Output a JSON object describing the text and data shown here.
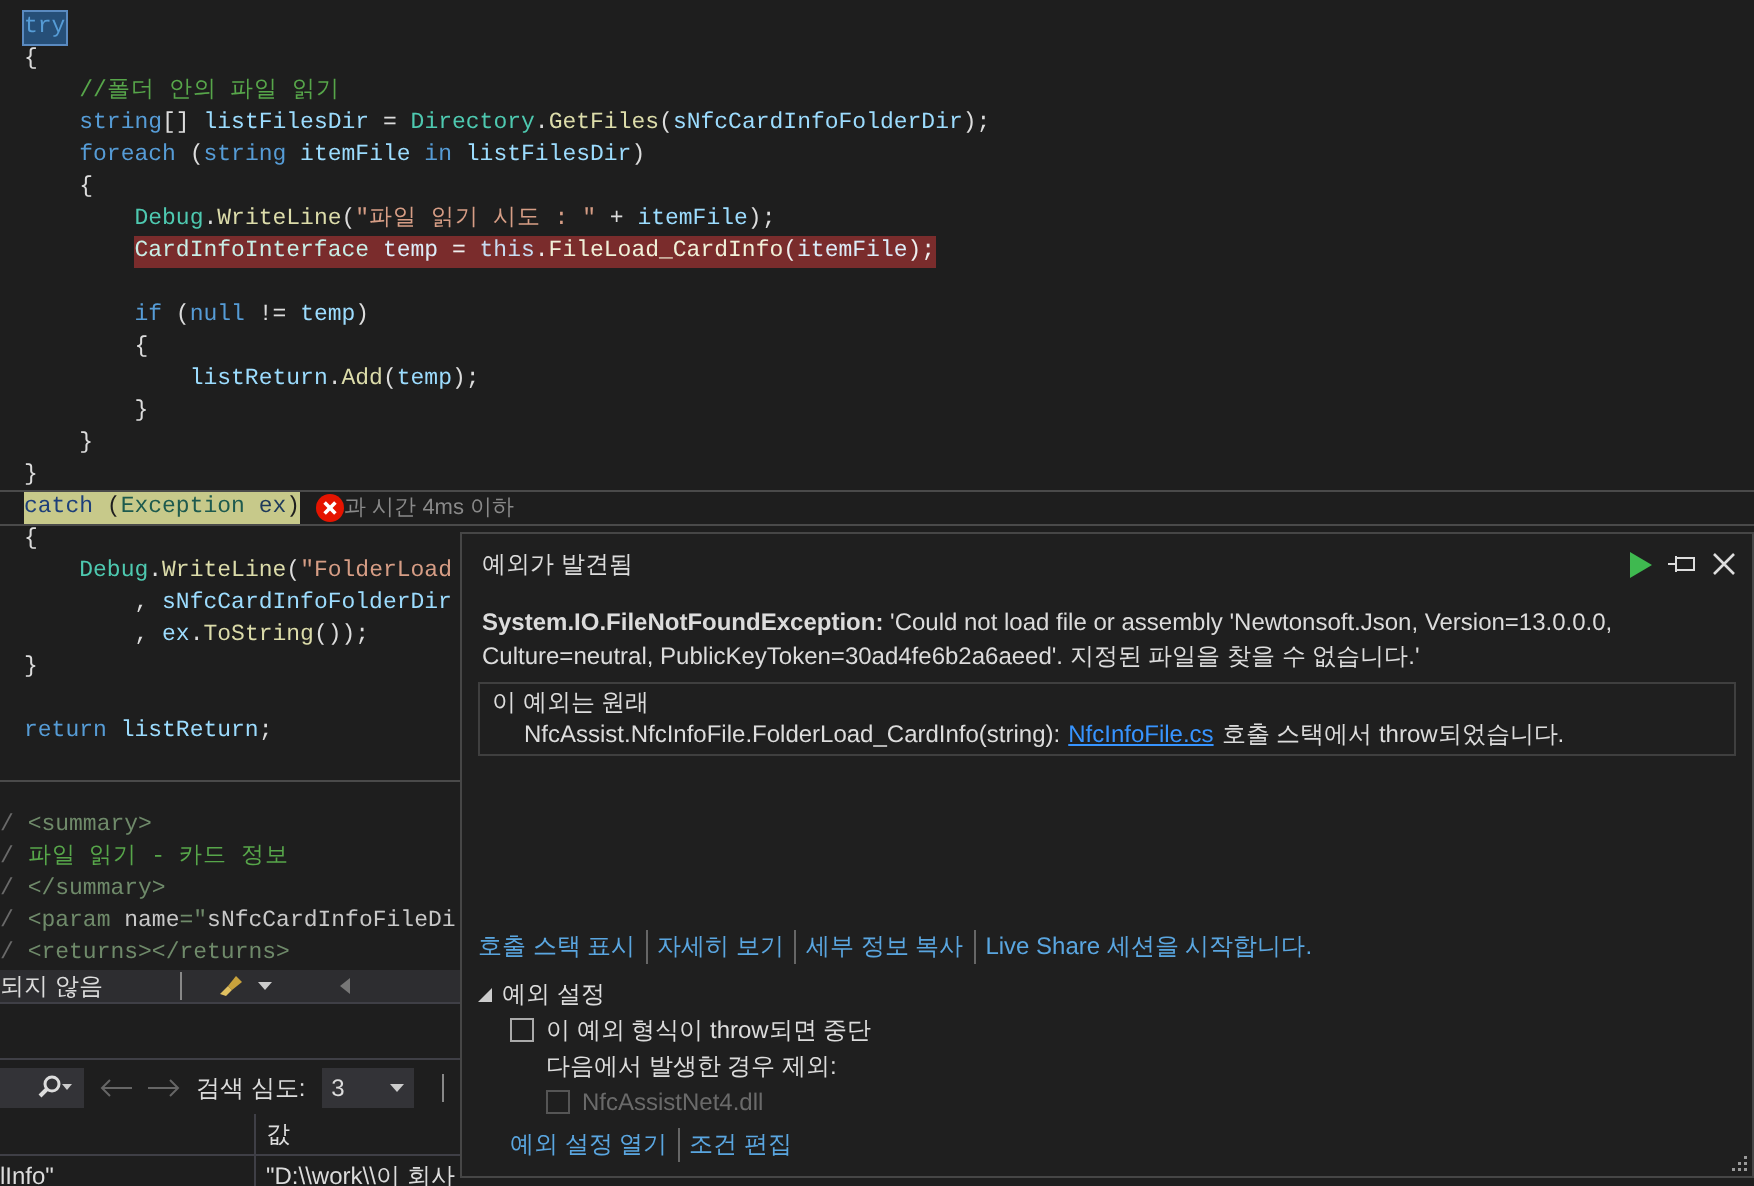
{
  "code_lines": [
    {
      "kind": "selected",
      "tokens": [
        {
          "kind": "keyword",
          "text": "try"
        }
      ]
    },
    {
      "kind": "code",
      "tokens": [
        {
          "kind": "plain",
          "text": "{"
        }
      ]
    },
    {
      "kind": "code",
      "tokens": [
        {
          "kind": "comment",
          "text": "    //폴더 안의 파일 읽기"
        }
      ]
    },
    {
      "kind": "code",
      "tokens": [
        {
          "kind": "keyword",
          "text": "    string"
        },
        {
          "kind": "plain",
          "text": "[] "
        },
        {
          "kind": "variable",
          "text": "listFilesDir"
        },
        {
          "kind": "plain",
          "text": " = "
        },
        {
          "kind": "type",
          "text": "Directory"
        },
        {
          "kind": "plain",
          "text": "."
        },
        {
          "kind": "method",
          "text": "GetFiles"
        },
        {
          "kind": "plain",
          "text": "("
        },
        {
          "kind": "variable",
          "text": "sNfcCardInfoFolderDir"
        },
        {
          "kind": "plain",
          "text": ");"
        }
      ]
    },
    {
      "kind": "code",
      "tokens": [
        {
          "kind": "keyword",
          "text": "    foreach"
        },
        {
          "kind": "plain",
          "text": " ("
        },
        {
          "kind": "keyword",
          "text": "string"
        },
        {
          "kind": "variable",
          "text": " itemFile "
        },
        {
          "kind": "keyword",
          "text": "in"
        },
        {
          "kind": "variable",
          "text": " listFilesDir"
        },
        {
          "kind": "plain",
          "text": ")"
        }
      ]
    },
    {
      "kind": "code",
      "tokens": [
        {
          "kind": "plain",
          "text": "    {"
        }
      ]
    },
    {
      "kind": "code",
      "tokens": [
        {
          "kind": "type",
          "text": "        Debug"
        },
        {
          "kind": "plain",
          "text": "."
        },
        {
          "kind": "method",
          "text": "WriteLine"
        },
        {
          "kind": "plain",
          "text": "("
        },
        {
          "kind": "string",
          "text": "\"파일 읽기 시도 : \""
        },
        {
          "kind": "plain",
          "text": " + "
        },
        {
          "kind": "variable",
          "text": "itemFile"
        },
        {
          "kind": "plain",
          "text": ");"
        }
      ]
    },
    {
      "kind": "exception",
      "tokens": [
        {
          "kind": "type",
          "text": "        CardInfoInterface"
        },
        {
          "kind": "variable",
          "text": " temp"
        },
        {
          "kind": "plain",
          "text": " = "
        },
        {
          "kind": "keyword",
          "text": "this"
        },
        {
          "kind": "plain",
          "text": "."
        },
        {
          "kind": "method",
          "text": "FileLoad_CardInfo"
        },
        {
          "kind": "plain",
          "text": "("
        },
        {
          "kind": "variable",
          "text": "itemFile"
        },
        {
          "kind": "plain",
          "text": ");"
        }
      ]
    },
    {
      "kind": "blank"
    },
    {
      "kind": "code",
      "tokens": [
        {
          "kind": "keyword",
          "text": "        if"
        },
        {
          "kind": "plain",
          "text": " ("
        },
        {
          "kind": "keyword",
          "text": "null"
        },
        {
          "kind": "plain",
          "text": " != "
        },
        {
          "kind": "variable",
          "text": "temp"
        },
        {
          "kind": "plain",
          "text": ")"
        }
      ]
    },
    {
      "kind": "code",
      "tokens": [
        {
          "kind": "plain",
          "text": "        {"
        }
      ]
    },
    {
      "kind": "code",
      "tokens": [
        {
          "kind": "variable",
          "text": "            listReturn"
        },
        {
          "kind": "plain",
          "text": "."
        },
        {
          "kind": "method",
          "text": "Add"
        },
        {
          "kind": "plain",
          "text": "("
        },
        {
          "kind": "variable",
          "text": "temp"
        },
        {
          "kind": "plain",
          "text": ");"
        }
      ]
    },
    {
      "kind": "code",
      "tokens": [
        {
          "kind": "plain",
          "text": "        }"
        }
      ]
    },
    {
      "kind": "code",
      "tokens": [
        {
          "kind": "plain",
          "text": "    }"
        }
      ]
    },
    {
      "kind": "code",
      "tokens": [
        {
          "kind": "plain",
          "text": "}"
        }
      ]
    },
    {
      "kind": "current",
      "tokens": [
        {
          "kind": "keyword",
          "text": "catch"
        },
        {
          "kind": "plain",
          "text": " ("
        },
        {
          "kind": "type",
          "text": "Exception"
        },
        {
          "kind": "variable",
          "text": " ex"
        },
        {
          "kind": "plain",
          "text": ")"
        }
      ],
      "hint": "과 시간 4ms 이하"
    },
    {
      "kind": "code",
      "tokens": [
        {
          "kind": "plain",
          "text": "{"
        }
      ]
    },
    {
      "kind": "code",
      "tokens": [
        {
          "kind": "type",
          "text": "    Debug"
        },
        {
          "kind": "plain",
          "text": "."
        },
        {
          "kind": "method",
          "text": "WriteLine"
        },
        {
          "kind": "plain",
          "text": "("
        },
        {
          "kind": "string",
          "text": "\"FolderLoad"
        }
      ]
    },
    {
      "kind": "code",
      "tokens": [
        {
          "kind": "plain",
          "text": "        , "
        },
        {
          "kind": "variable",
          "text": "sNfcCardInfoFolderDir"
        }
      ]
    },
    {
      "kind": "code",
      "tokens": [
        {
          "kind": "plain",
          "text": "        , "
        },
        {
          "kind": "variable",
          "text": "ex"
        },
        {
          "kind": "plain",
          "text": "."
        },
        {
          "kind": "method",
          "text": "ToString"
        },
        {
          "kind": "plain",
          "text": "());"
        }
      ]
    },
    {
      "kind": "code",
      "tokens": [
        {
          "kind": "plain",
          "text": "}"
        }
      ]
    },
    {
      "kind": "blank"
    },
    {
      "kind": "code",
      "tokens": [
        {
          "kind": "keyword",
          "text": "return"
        },
        {
          "kind": "variable",
          "text": " listReturn"
        },
        {
          "kind": "plain",
          "text": ";"
        }
      ]
    }
  ],
  "doc_lines": [
    {
      "tokens": [
        {
          "kind": "doc-slash",
          "text": "/ "
        },
        {
          "kind": "doc-tag",
          "text": "<summary>"
        }
      ]
    },
    {
      "tokens": [
        {
          "kind": "doc-slash",
          "text": "/ "
        },
        {
          "kind": "comment",
          "text": "파일 읽기 - 카드 정보"
        }
      ]
    },
    {
      "tokens": [
        {
          "kind": "doc-slash",
          "text": "/ "
        },
        {
          "kind": "doc-tag",
          "text": "</summary>"
        }
      ]
    },
    {
      "tokens": [
        {
          "kind": "doc-slash",
          "text": "/ "
        },
        {
          "kind": "doc-tag",
          "text": "<param "
        },
        {
          "kind": "doc-attr",
          "text": "name"
        },
        {
          "kind": "doc-tag",
          "text": "=\""
        },
        {
          "kind": "doc-attr",
          "text": "sNfcCardInfoFileDi"
        }
      ]
    },
    {
      "tokens": [
        {
          "kind": "doc-slash",
          "text": "/ "
        },
        {
          "kind": "doc-tag",
          "text": "<returns></returns>"
        }
      ]
    }
  ],
  "toolbar": {
    "status": "되지 않음"
  },
  "search_bar": {
    "depth_label": "검색 심도:",
    "depth_value": "3"
  },
  "table": {
    "columns": [
      "값"
    ],
    "rows": [
      {
        "column_1": "lInfo\"",
        "value": "\"D:\\\\work\\\\이 회사"
      }
    ]
  },
  "exception_popup": {
    "title": "예외가 발견됨",
    "message": "**System.IO.FileNotFoundException:** 'Could not load file or assembly 'Newtonsoft.Json, Version=13.0.0.0, Culture=neutral, PublicKeyToken=30ad4fe6b2a6aeed'. 지정된 파일을 찾을 수 없습니다.'",
    "origin_title": "이 예외는 원래",
    "origin_method": "NfcAssist.NfcInfoFile.FolderLoad_CardInfo(string):",
    "origin_link": "NfcInfoFile.cs",
    "origin_suffix": "호출 스택에서 throw되었습니다.",
    "links": [
      "호출 스택 표시",
      "자세히 보기",
      "세부 정보 복사",
      "Live Share 세션을 시작합니다."
    ],
    "settings": {
      "title": "예외 설정",
      "expanded": true,
      "break_option": {
        "label": "이 예외 형식이 throw되면 중단",
        "checked": false
      },
      "except_label": "다음에서 발생한 경우 제외:",
      "modules": [
        {
          "label": "NfcAssistNet4.dll",
          "checked": false,
          "disabled": true
        }
      ]
    },
    "bottom_links": [
      "예외 설정 열기",
      "조건 편집"
    ]
  }
}
